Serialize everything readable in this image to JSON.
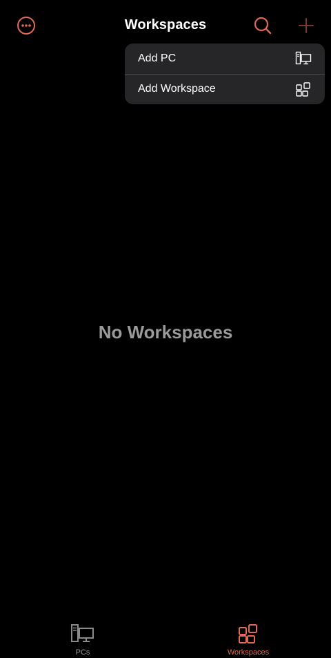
{
  "header": {
    "title": "Workspaces",
    "more_icon": "ellipsis-circle-icon",
    "search_icon": "search-icon",
    "add_icon": "plus-icon"
  },
  "add_menu": {
    "items": [
      {
        "label": "Add PC",
        "icon": "pc-icon"
      },
      {
        "label": "Add Workspace",
        "icon": "workspace-grid-icon"
      }
    ]
  },
  "main": {
    "empty_message": "No Workspaces"
  },
  "tab_bar": {
    "tabs": [
      {
        "label": "PCs",
        "icon": "pc-icon",
        "selected": false
      },
      {
        "label": "Workspaces",
        "icon": "workspace-grid-icon",
        "selected": true
      }
    ]
  },
  "colors": {
    "accent": "#e06a55",
    "background": "#000000",
    "menu_background": "#262628",
    "muted_text": "#9a9a9a"
  }
}
